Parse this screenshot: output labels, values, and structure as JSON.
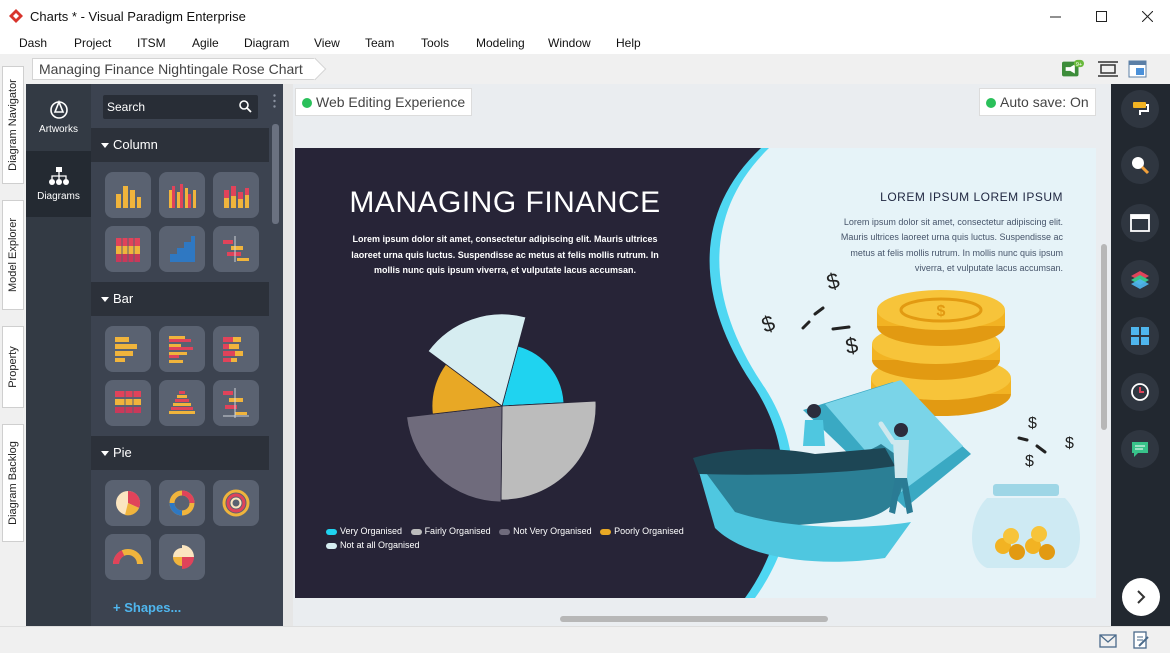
{
  "window": {
    "title": "Charts * - Visual Paradigm Enterprise"
  },
  "menu": [
    "Dash",
    "Project",
    "ITSM",
    "Agile",
    "Diagram",
    "View",
    "Team",
    "Tools",
    "Modeling",
    "Window",
    "Help"
  ],
  "breadcrumb": "Managing Finance Nightingale Rose Chart",
  "notification_count": "9+",
  "side_tabs": [
    "Diagram Navigator",
    "Model Explorer",
    "Property",
    "Diagram Backlog"
  ],
  "palette": {
    "nav": [
      "Artworks",
      "Diagrams"
    ],
    "search_placeholder": "Search",
    "categories": [
      "Column",
      "Bar",
      "Pie"
    ],
    "shapes_link": "+ Shapes..."
  },
  "editor": {
    "web_editing": "Web Editing Experience",
    "auto_save": "Auto save: On"
  },
  "canvas": {
    "title": "MANAGING FINANCE",
    "body": "Lorem ipsum dolor sit amet, consectetur adipiscing elit. Mauris ultrices laoreet urna quis luctus. Suspendisse ac metus at felis mollis rutrum. In mollis nunc quis ipsum viverra, et vulputate lacus accumsan.",
    "right_title": "LOREM IPSUM LOREM IPSUM",
    "right_body": "Lorem ipsum dolor sit amet, consectetur adipiscing elit. Mauris ultrices laoreet urna quis luctus. Suspendisse ac metus at felis mollis rutrum. In mollis nunc quis ipsum viverra, et vulputate lacus accumsan."
  },
  "chart_data": {
    "type": "pie",
    "chart_kind": "nightingale-rose",
    "slices": [
      {
        "label": "Very Organised",
        "value": 20,
        "radius": 62,
        "color": "#1fd3f0"
      },
      {
        "label": "Fairly Organised",
        "value": 26,
        "radius": 94,
        "color": "#bcbcbc"
      },
      {
        "label": "Not Very Organised",
        "value": 23,
        "radius": 96,
        "color": "#6f6b7c"
      },
      {
        "label": "Poorly Organised",
        "value": 12,
        "radius": 70,
        "color": "#e8a825"
      },
      {
        "label": "Not at all Organised",
        "value": 19,
        "radius": 92,
        "color": "#d6edf1"
      }
    ]
  },
  "colors": {
    "canvas_bg": "#272437",
    "accent": "#1fd3f0",
    "green": "#2ac05a"
  }
}
